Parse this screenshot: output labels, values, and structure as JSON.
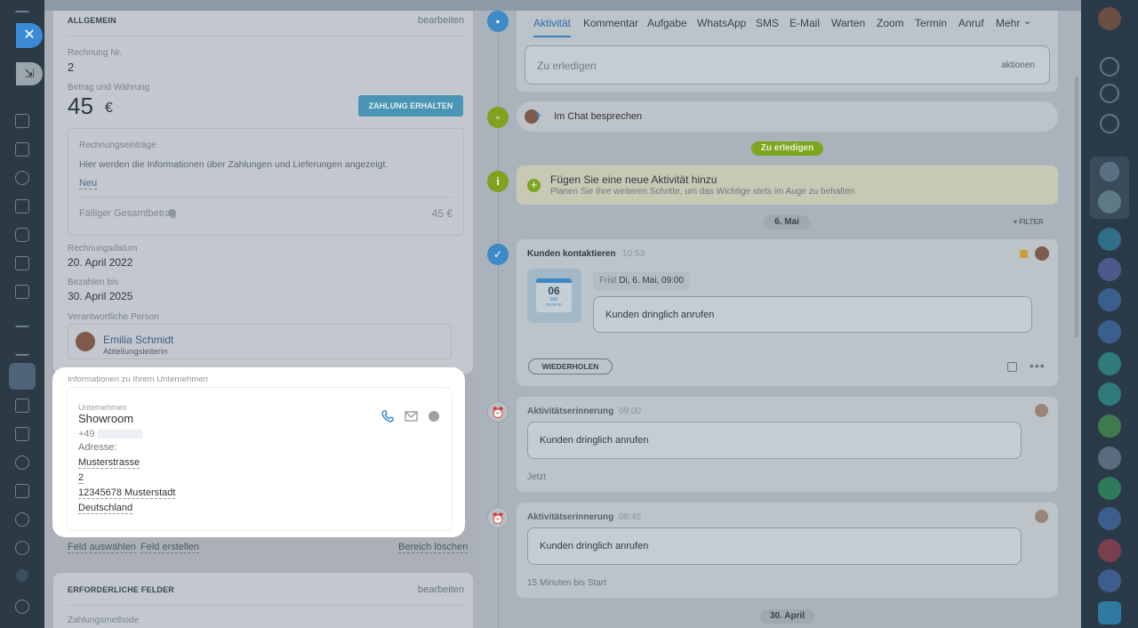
{
  "left": {
    "general_header": "ALLGEMEIN",
    "edit_label": "bearbeiten",
    "invoice_no_label": "Rechnung Nr.",
    "invoice_no": "2",
    "amount_label": "Betrag und Währung",
    "amount": "45",
    "currency": "€",
    "pay_button": "ZAHLUNG ERHALTEN",
    "items_label": "Rechnungseinträge",
    "items_info": "Hier werden die Informationen über Zahlungen und Lieferungen angezeigt.",
    "new_link": "Neu",
    "total_label": "Fälliger Gesamtbetrag",
    "total_value": "45 €",
    "invoice_date_label": "Rechnungsdatum",
    "invoice_date": "20. April 2022",
    "pay_until_label": "Bezahlen bis",
    "pay_until": "30. April 2025",
    "responsible_label": "Verantwortliche Person",
    "responsible_name": "Emilia Schmidt",
    "responsible_role": "Abteilungsleiterin",
    "company_section": "Informationen zu Ihrem Unternehmen",
    "company_label": "Unternehmen",
    "company_name": "Showroom",
    "phone_prefix": "+49",
    "address_label": "Adresse:",
    "address_street": "Musterstrasse",
    "address_no": "2",
    "address_city": "12345678 Musterstadt",
    "address_country": "Deutschland",
    "select_field": "Feld auswählen",
    "create_field": "Feld erstellen",
    "delete_section": "Bereich löschen",
    "required_header": "ERFORDERLICHE FELDER",
    "required_edit": "bearbeiten",
    "payment_method_label": "Zahlungsmethode"
  },
  "right": {
    "tabs": [
      "Aktivität",
      "Kommentar",
      "Aufgabe",
      "WhatsApp",
      "SMS",
      "E-Mail",
      "Warten",
      "Zoom",
      "Termin",
      "Anruf",
      "Mehr"
    ],
    "todo_placeholder": "Zu erledigen",
    "actions_label": "aktionen",
    "chat_label": "Im Chat besprechen",
    "todo_badge": "Zu erledigen",
    "add_activity_title": "Fügen Sie eine neue Aktivität hinzu",
    "add_activity_sub": "Planen Sie Ihre weiteren Schritte, um das Wichtige stets im Auge zu behalten",
    "date_may": "6. Mai",
    "filter_label": "FILTER",
    "contact_title": "Kunden kontaktieren",
    "contact_time": "10:53",
    "cal_day": "06",
    "cal_month": "MAI",
    "cal_time": "09:00-00",
    "deadline_label": "Frist",
    "deadline_value": "Di, 6. Mai, 09:00",
    "contact_text": "Kunden dringlich anrufen",
    "repeat_button": "WIEDERHOLEN",
    "reminder1_title": "Aktivitätserinnerung",
    "reminder1_time": "09:00",
    "reminder1_text": "Kunden dringlich anrufen",
    "reminder1_status": "Jetzt",
    "reminder2_title": "Aktivitätserinnerung",
    "reminder2_time": "08:45",
    "reminder2_text": "Kunden dringlich anrufen",
    "reminder2_status": "15 Minuten bis Start",
    "date_april": "30. April"
  }
}
